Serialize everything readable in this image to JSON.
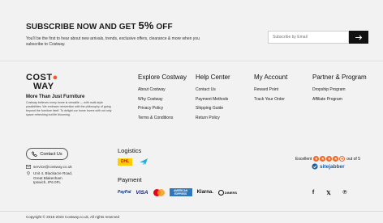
{
  "subscribe": {
    "title_prefix": "SUBSCRIBE NOW AND GET",
    "title_percent": "5%",
    "title_suffix": "OFF",
    "description": "You'll be the first to hear about new arrivals, trends, exclusive offers, clearance & more when you subscribe to Costway.",
    "email_placeholder": "Subscribe by Email",
    "submit_icon": "arrow-right-icon"
  },
  "brand": {
    "logo_line1": "COST",
    "logo_line2": "WAY",
    "logo_accent_color": "#f05a28",
    "tagline": "More Than Just Furniture",
    "about": "Costway believes every home is versatile — with multi-style possibilities. We embrace reinvention with the philosophy of going beyond the furniture itself. To delight our home lovers with not only space refreshing but life blooming."
  },
  "columns": [
    {
      "heading": "Explore Costway",
      "links": [
        "About Costway",
        "Why Costway",
        "Privacy Policy",
        "Terms & Conditions"
      ]
    },
    {
      "heading": "Help Center",
      "links": [
        "Contact Us",
        "Payment Methods",
        "Shipping Guide",
        "Return Policy"
      ]
    },
    {
      "heading": "My Account",
      "links": [
        "Reward Point",
        "Track Your Order"
      ]
    },
    {
      "heading": "Partner & Program",
      "links": [
        "Dropship Program",
        "Affiliate Program"
      ]
    }
  ],
  "contact": {
    "button_label": "Contact Us",
    "email": "service@costway.co.uk",
    "address_line1": "Unit 4, Blackacre Road,",
    "address_line2": "Great Blakenham",
    "address_line3": "Ipswich, IP6 0FL"
  },
  "logistics": {
    "heading": "Logistics",
    "carriers": [
      "DHL",
      "plane-icon"
    ]
  },
  "payment": {
    "heading": "Payment",
    "methods": {
      "paypal": "PayPal",
      "visa": "VISA",
      "amex_line1": "AMERICAN",
      "amex_line2": "EXPRESS",
      "klarna": "Klarna.",
      "diners": "DINERS"
    }
  },
  "rating": {
    "label": "Excellent",
    "stars_filled": 4,
    "stars_total": 5,
    "score_text": "out of 5",
    "provider": "sitejabber",
    "star_color": "#f26722"
  },
  "social": {
    "facebook": "f",
    "twitter": "𝕏",
    "pinterest": "℗"
  },
  "copyright": "Copyright © 2015-2023 Costway.co.uk, All rights reserved"
}
